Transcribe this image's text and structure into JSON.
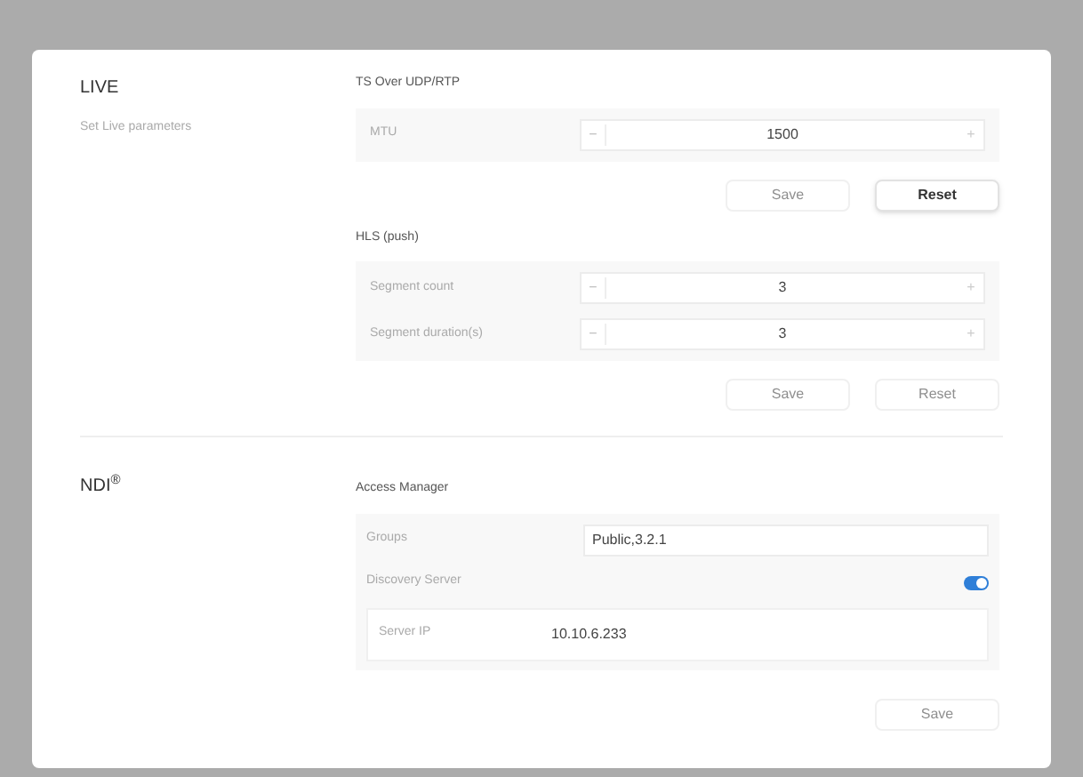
{
  "live": {
    "title": "LIVE",
    "description": "Set Live parameters",
    "groups": [
      {
        "title": "TS Over UDP/RTP",
        "rows": [
          {
            "label": "MTU",
            "minus": "−",
            "value": "1500",
            "plus": "+"
          }
        ],
        "buttons": [
          {
            "label": "Save",
            "disabled": true
          },
          {
            "label": "Reset",
            "disabled": false
          }
        ]
      },
      {
        "title": "HLS (push)",
        "rows": [
          {
            "label": "Segment count",
            "minus": "−",
            "value": "3",
            "plus": "+"
          },
          {
            "label": "Segment duration(s)",
            "minus": "−",
            "value": "3",
            "plus": "+"
          }
        ],
        "buttons": [
          {
            "label": "Save",
            "disabled": true
          },
          {
            "label": "Reset",
            "disabled": true
          }
        ]
      }
    ]
  },
  "ndi": {
    "title": "NDI$^{®}$",
    "section": "Access Manager",
    "groups_label": "Groups",
    "groups_value": "Public,3.2.1",
    "discovery_label": "Discovery Server",
    "discovery_on": true,
    "server_ip_label": "Server IP",
    "server_ip_value": "10.10.6.233",
    "save": {
      "label": "Save",
      "disabled": true
    }
  }
}
